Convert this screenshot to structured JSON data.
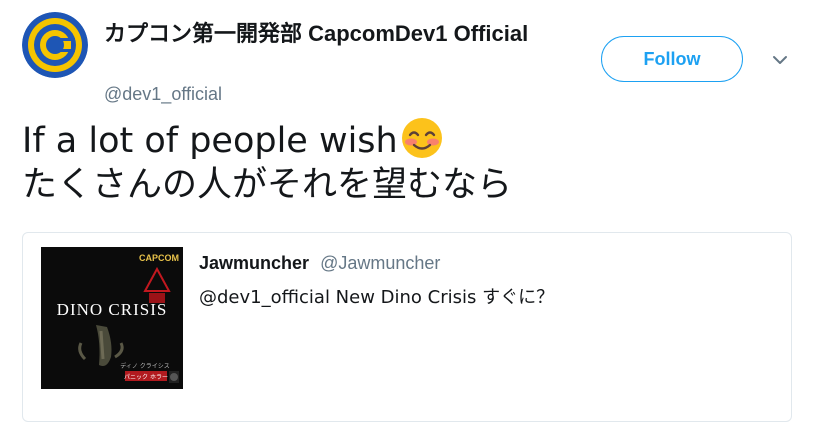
{
  "profile": {
    "display_name": "カプコン第一開発部 CapcomDev1 Official",
    "handle": "@dev1_official",
    "avatar_icon": "capcom-c-logo-icon",
    "avatar_colors": {
      "ring": "#1e56b5",
      "fill": "#f5c400"
    }
  },
  "actions": {
    "follow_label": "Follow",
    "more_icon": "chevron-down-icon",
    "accent": "#1da1f2"
  },
  "tweet": {
    "line1": "If a lot of people wish",
    "line2": "たくさんの人がそれを望むなら",
    "emoji_icon": "smiling-face-with-blush-emoji"
  },
  "quoted_tweet": {
    "author_name": "Jawmuncher",
    "author_handle": "@Jawmuncher",
    "text": "@dev1_official New Dino Crisis すぐに？",
    "thumbnail": {
      "publisher": "CAPCOM",
      "title": "DINO CRISIS",
      "subtitle": "ディノ クライシス",
      "tag": "パニック ホラー"
    }
  }
}
